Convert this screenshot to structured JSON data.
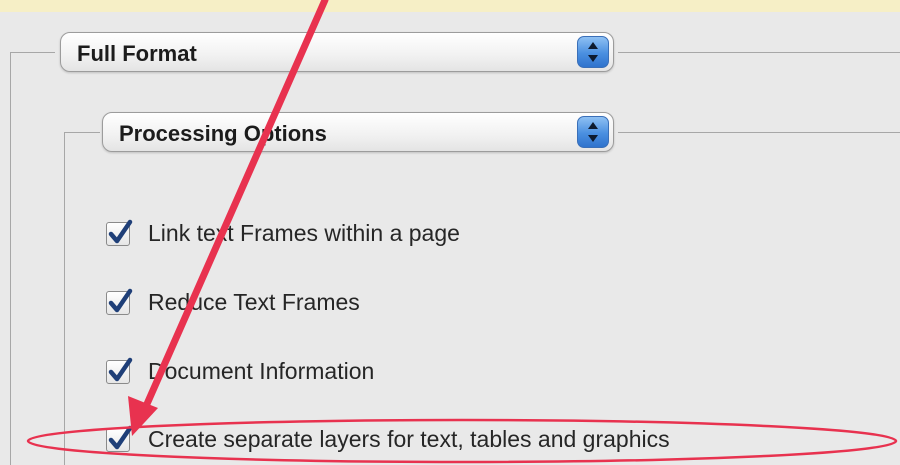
{
  "format_popup": {
    "label": "Full Format",
    "icon": "stepper-arrows-icon"
  },
  "options_popup": {
    "label": "Processing Options",
    "icon": "stepper-arrows-icon"
  },
  "options": [
    {
      "label": "Link text Frames within a page",
      "checked": true
    },
    {
      "label": "Reduce Text Frames",
      "checked": true
    },
    {
      "label": "Document Information",
      "checked": true
    },
    {
      "label": "Create separate layers for text, tables and graphics",
      "checked": true
    }
  ],
  "annotation": {
    "color": "#e8324f",
    "shapes": [
      "arrow",
      "ellipse-highlight"
    ]
  },
  "colors": {
    "accent": "#4a8fe0",
    "background": "#f6efc6",
    "panel": "#e9e9e9"
  }
}
